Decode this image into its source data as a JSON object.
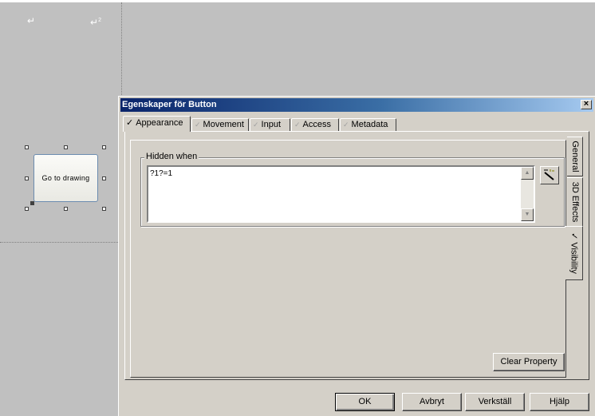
{
  "canvas": {
    "marker_1": "↵",
    "marker_2": "↵",
    "marker_2_sup": "2",
    "design_button_label": "Go to drawing"
  },
  "dialog": {
    "title": "Egenskaper för Button",
    "close_label": "×",
    "tabs": [
      {
        "label": "Appearance",
        "check": "✓",
        "active": true
      },
      {
        "label": "Movement",
        "check": "✓",
        "active": false
      },
      {
        "label": "Input",
        "check": "✓",
        "active": false
      },
      {
        "label": "Access",
        "check": "✓",
        "active": false
      },
      {
        "label": "Metadata",
        "check": "✓",
        "active": false
      }
    ],
    "side_tabs": [
      {
        "label": "General",
        "active": false
      },
      {
        "label": "3D Effects",
        "active": false
      },
      {
        "label": "Visibility",
        "check": "✓",
        "active": true
      }
    ],
    "hidden_when": {
      "label": "Hidden when",
      "value": "?1?=1"
    },
    "clear_property_label": "Clear Property",
    "buttons": {
      "ok": "OK",
      "cancel": "Avbryt",
      "apply": "Verkställ",
      "help": "Hjälp"
    }
  }
}
